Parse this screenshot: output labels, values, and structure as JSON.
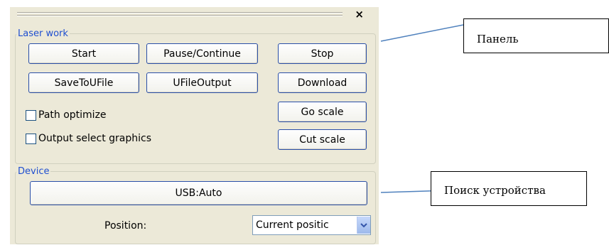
{
  "panel": {
    "close_glyph": "×",
    "laser_work": {
      "legend": "Laser work",
      "buttons": {
        "start": "Start",
        "pause_continue": "Pause/Continue",
        "stop": "Stop",
        "save_to_ufile": "SaveToUFile",
        "ufile_output": "UFileOutput",
        "download": "Download",
        "go_scale": "Go scale",
        "cut_scale": "Cut scale"
      },
      "checkboxes": {
        "path_optimize": {
          "label": "Path optimize",
          "checked": false
        },
        "output_select_graphics": {
          "label": "Output select graphics",
          "checked": false
        }
      }
    },
    "device": {
      "legend": "Device",
      "usb_button": "USB:Auto",
      "position_label": "Position:",
      "position_select": {
        "value": "Current positic",
        "arrow_icon": "chevron-down-icon"
      }
    }
  },
  "callouts": {
    "panel_label": "Панель",
    "device_search_label": "Поиск устройства"
  },
  "colors": {
    "panel_bg": "#ece9d8",
    "legend_text": "#1f4fd0",
    "button_border": "#2a4fa8",
    "callout_line": "#4f81bd"
  }
}
